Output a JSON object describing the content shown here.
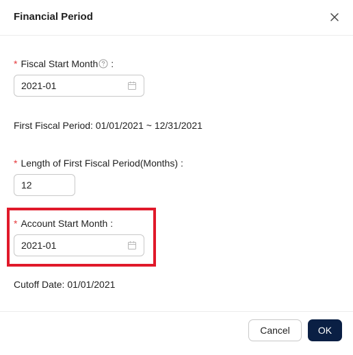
{
  "dialog": {
    "title": "Financial Period",
    "close_icon": "close-icon"
  },
  "fields": {
    "fiscal_start_month": {
      "required_mark": "*",
      "label": "Fiscal Start Month",
      "help_icon": "question-circle-icon",
      "colon": ":",
      "value": "2021-01",
      "icon": "calendar-icon"
    },
    "first_fiscal_period_text": "First Fiscal Period: 01/01/2021 ~ 12/31/2021",
    "length_first_period": {
      "required_mark": "*",
      "label": "Length of First Fiscal Period(Months)",
      "colon": ":",
      "value": "12"
    },
    "account_start_month": {
      "required_mark": "*",
      "label": "Account Start Month",
      "colon": ":",
      "value": "2021-01",
      "icon": "calendar-icon"
    },
    "cutoff_date_text": "Cutoff Date: 01/01/2021"
  },
  "footer": {
    "cancel_label": "Cancel",
    "ok_label": "OK"
  },
  "colors": {
    "required": "#e5383b",
    "primary_button": "#0a1f44",
    "highlight_box": "#e0192a"
  }
}
